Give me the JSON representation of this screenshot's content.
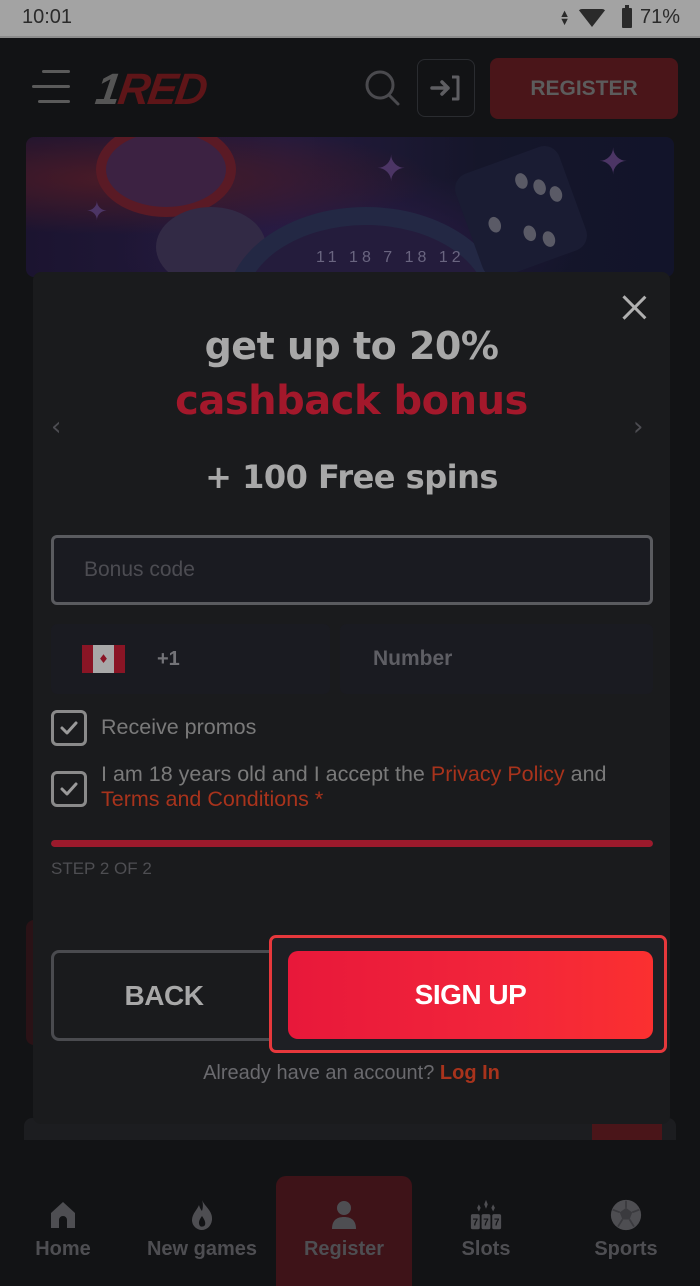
{
  "status_bar": {
    "time": "10:01",
    "battery": "71%"
  },
  "header": {
    "logo_prefix": "1",
    "logo_text": "RED",
    "register_label": "REGISTER"
  },
  "banner": {
    "wheel_numbers": "11 18 7 18 12"
  },
  "modal": {
    "headline_line1": "get up to 20%",
    "headline_line2": "cashback bonus",
    "headline_line3": "+ 100 Free spins",
    "bonus_code_placeholder": "Bonus code",
    "country_code": "+1",
    "country": "Canada",
    "phone_placeholder": "Number",
    "checkbox_promos": {
      "label": "Receive promos",
      "checked": true
    },
    "checkbox_terms": {
      "text_before": "I am 18 years old and I accept the ",
      "privacy_link": "Privacy Policy",
      "text_middle": " and ",
      "terms_link": "Terms and Conditions",
      "required_mark": " *",
      "checked": true
    },
    "progress_fraction": 1.0,
    "step_label": "STEP 2 OF 2",
    "back_label": "BACK",
    "signup_label": "SIGN UP",
    "already_text": "Already have an account? ",
    "login_link": "Log In"
  },
  "colors": {
    "accent_red": "#f2253a",
    "link_orange": "#a8331c",
    "headline_red": "#a3182b"
  },
  "bottom_nav": {
    "items": [
      {
        "label": "Home",
        "icon": "home-icon"
      },
      {
        "label": "New games",
        "icon": "flame-icon"
      },
      {
        "label": "Register",
        "icon": "user-icon",
        "active": true
      },
      {
        "label": "Slots",
        "icon": "slots-icon"
      },
      {
        "label": "Sports",
        "icon": "soccer-ball-icon"
      }
    ]
  }
}
